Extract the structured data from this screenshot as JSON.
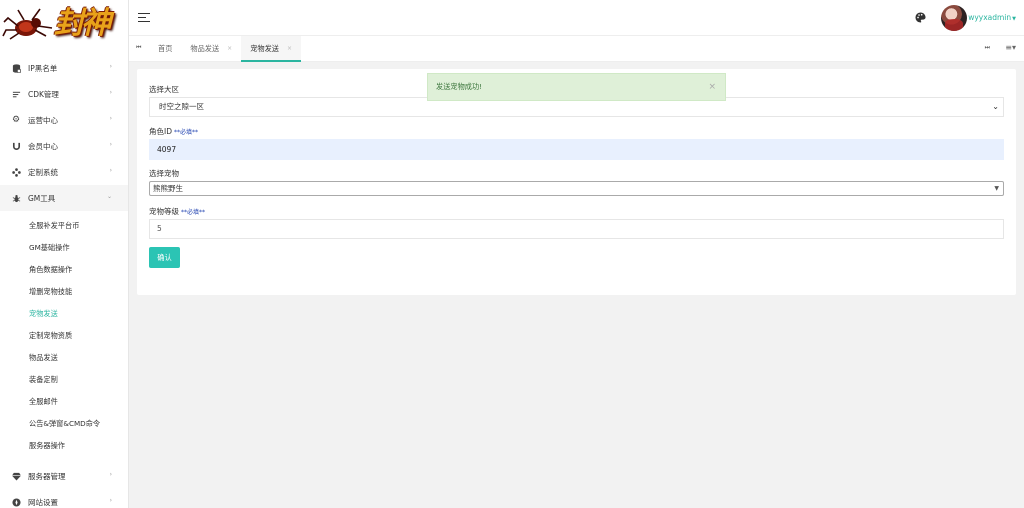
{
  "sidebar": {
    "logo_text": "封神",
    "menu": [
      {
        "label": "IP黑名单",
        "icon": "database-icon"
      },
      {
        "label": "CDK管理",
        "icon": "filter-lines-icon"
      },
      {
        "label": "运营中心",
        "icon": "gear-icon"
      },
      {
        "label": "会员中心",
        "icon": "magnet-icon"
      },
      {
        "label": "定制系统",
        "icon": "diamond-dots-icon"
      },
      {
        "label": "GM工具",
        "icon": "bug-icon"
      }
    ],
    "gm_submenu": [
      "全服补发平台币",
      "GM基础操作",
      "角色数据操作",
      "增删宠物技能",
      "宠物发送",
      "定制宠物资质",
      "物品发送",
      "装备定制",
      "全服邮件",
      "公告&弹窗&CMD命令",
      "服务器操作"
    ],
    "gm_active_index": 4,
    "bottom_menu": [
      {
        "label": "服务器管理",
        "icon": "diamond-icon"
      },
      {
        "label": "网站设置",
        "icon": "compass-icon"
      }
    ],
    "accent_color": "#2bb5a0"
  },
  "topbar": {
    "username": "wyyxadmin"
  },
  "tabs": [
    {
      "label": "首页",
      "closable": false,
      "active": false
    },
    {
      "label": "物品发送",
      "closable": true,
      "active": false
    },
    {
      "label": "宠物发送",
      "closable": true,
      "active": true
    }
  ],
  "form": {
    "server_label": "选择大区",
    "server_value": "时空之隙一区",
    "role_label": "角色ID",
    "role_required": "**必填**",
    "role_value": "4097",
    "pet_label": "选择宠物",
    "pet_value": "熊熊野生",
    "level_label": "宠物等级",
    "level_required": "**必填**",
    "level_value": "5",
    "confirm_label": "确认"
  },
  "toast": {
    "message": "发送宠物成功!",
    "close": "×"
  }
}
